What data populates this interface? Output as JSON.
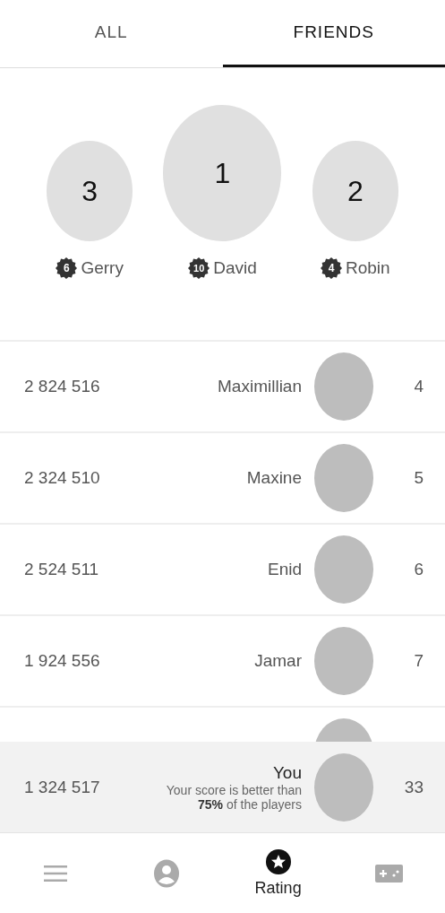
{
  "tabs": [
    {
      "label": "ALL",
      "selected": false
    },
    {
      "label": "FRIENDS",
      "selected": true
    }
  ],
  "podium": [
    {
      "place": "3",
      "name": "Gerry",
      "badge": "6"
    },
    {
      "place": "1",
      "name": "David",
      "badge": "10"
    },
    {
      "place": "2",
      "name": "Robin",
      "badge": "4"
    }
  ],
  "rows": [
    {
      "kind": "full",
      "score": "2 824 516",
      "name": "Maximillian",
      "rank": "4"
    },
    {
      "kind": "full",
      "score": "2 324 510",
      "name": "Maxine",
      "rank": "5"
    },
    {
      "kind": "full",
      "score": "2 524 511",
      "name": "Enid",
      "rank": "6"
    },
    {
      "kind": "full",
      "score": "1 924 556",
      "name": "Jamar",
      "rank": "7"
    },
    {
      "kind": "avatar_only"
    }
  ],
  "you": {
    "score": "1 324 517",
    "name": "You",
    "note": "Your score is better than",
    "note2": "**75%** of the players",
    "rank": "33"
  },
  "nav": [
    {
      "kind": "menu",
      "selected": false
    },
    {
      "kind": "person",
      "selected": false
    },
    {
      "kind": "star",
      "label": "Rating",
      "selected": true
    },
    {
      "kind": "gamepad",
      "selected": false
    }
  ]
}
